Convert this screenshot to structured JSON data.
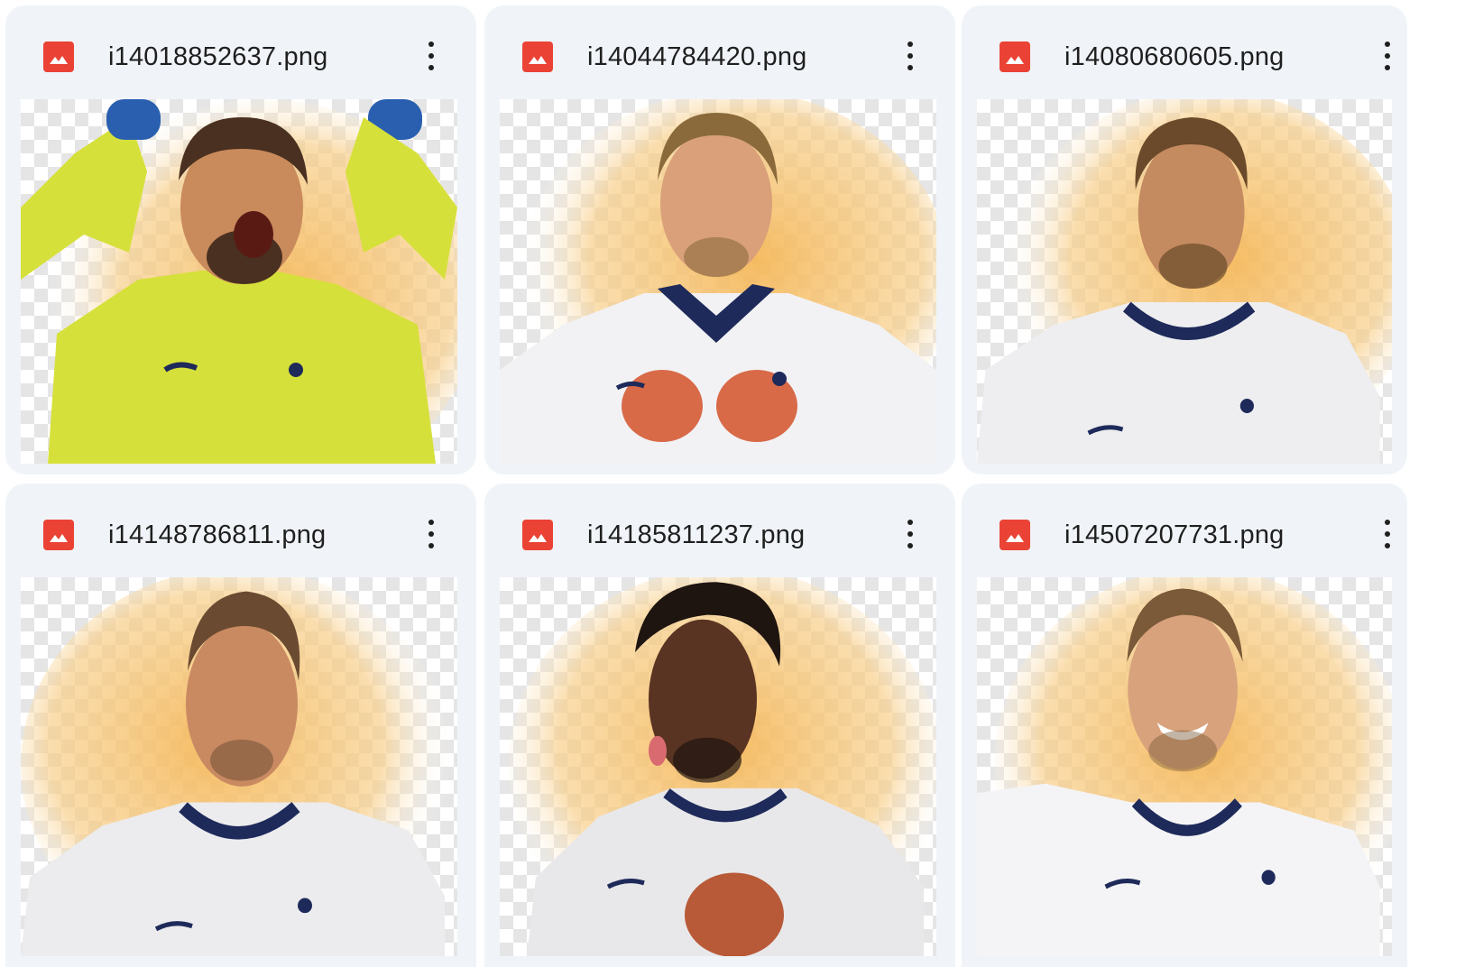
{
  "files": [
    {
      "name": "i14018852637.png",
      "icon": "image-file-icon",
      "jersey_color": "#d6e03a",
      "skin": "#c98a5c",
      "hair": "#4a3020"
    },
    {
      "name": "i14044784420.png",
      "icon": "image-file-icon",
      "jersey_color": "#f2f2f4",
      "skin": "#d9a07a",
      "hair": "#8a6a3a"
    },
    {
      "name": "i14080680605.png",
      "icon": "image-file-icon",
      "jersey_color": "#eeeef0",
      "skin": "#c48a60",
      "hair": "#6a4a2a"
    },
    {
      "name": "i14148786811.png",
      "icon": "image-file-icon",
      "jersey_color": "#ececee",
      "skin": "#c98a62",
      "hair": "#6a4a30"
    },
    {
      "name": "i14185811237.png",
      "icon": "image-file-icon",
      "jersey_color": "#e8e8ea",
      "skin": "#5a3422",
      "hair": "#1e1410"
    },
    {
      "name": "i14507207731.png",
      "icon": "image-file-icon",
      "jersey_color": "#f4f4f6",
      "skin": "#d8a27c",
      "hair": "#7a5a38"
    }
  ],
  "colors": {
    "card_bg": "#f0f4f9",
    "icon_red": "#ea4335",
    "glow": "#f5b85a",
    "navy": "#1e2a5a"
  }
}
